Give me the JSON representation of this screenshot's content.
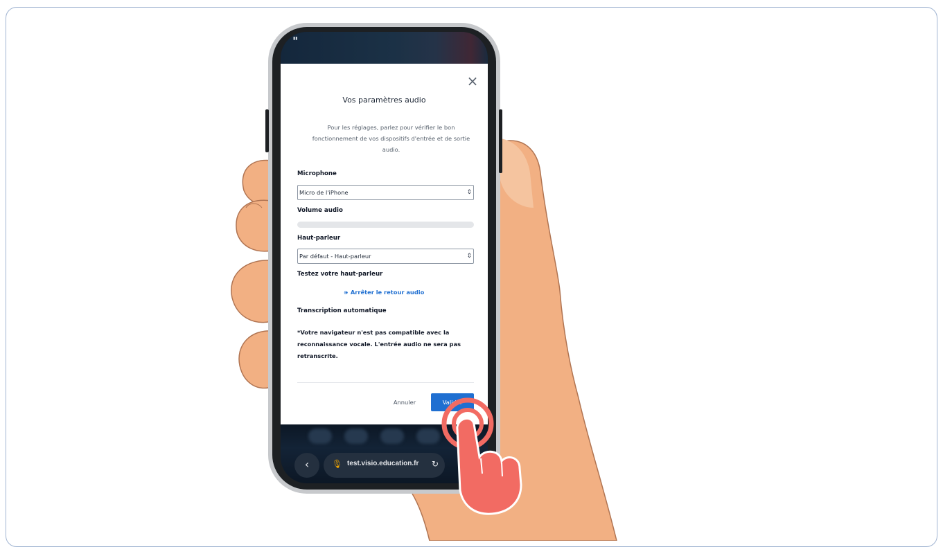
{
  "modal": {
    "close_icon": "close-icon",
    "title": "Vos paramètres audio",
    "description": "Pour les réglages, parlez pour vérifier le bon fonctionnement de vos dispositifs d'entrée et de sortie audio.",
    "microphone_label": "Microphone",
    "microphone_value": "Micro de l'iPhone",
    "volume_label": "Volume audio",
    "volume_level": 0,
    "speaker_label": "Haut-parleur",
    "speaker_value": "Par défaut - Haut-parleur",
    "test_speaker_label": "Testez votre haut-parleur",
    "stop_feedback_label": "Arrêter le retour audio",
    "transcription_label": "Transcription automatique",
    "transcription_warning": "*Votre navigateur n'est pas compatible avec la reconnaissance vocale. L'entrée audio ne sera pas retranscrite.",
    "cancel_label": "Annuler",
    "validate_label": "Valider"
  },
  "browser": {
    "url": "test.visio.education.fr",
    "back_icon": "chevron-left-icon",
    "reload_icon": "reload-icon"
  },
  "colors": {
    "accent": "#1f6fd1",
    "tap_indicator": "#f26b63"
  }
}
